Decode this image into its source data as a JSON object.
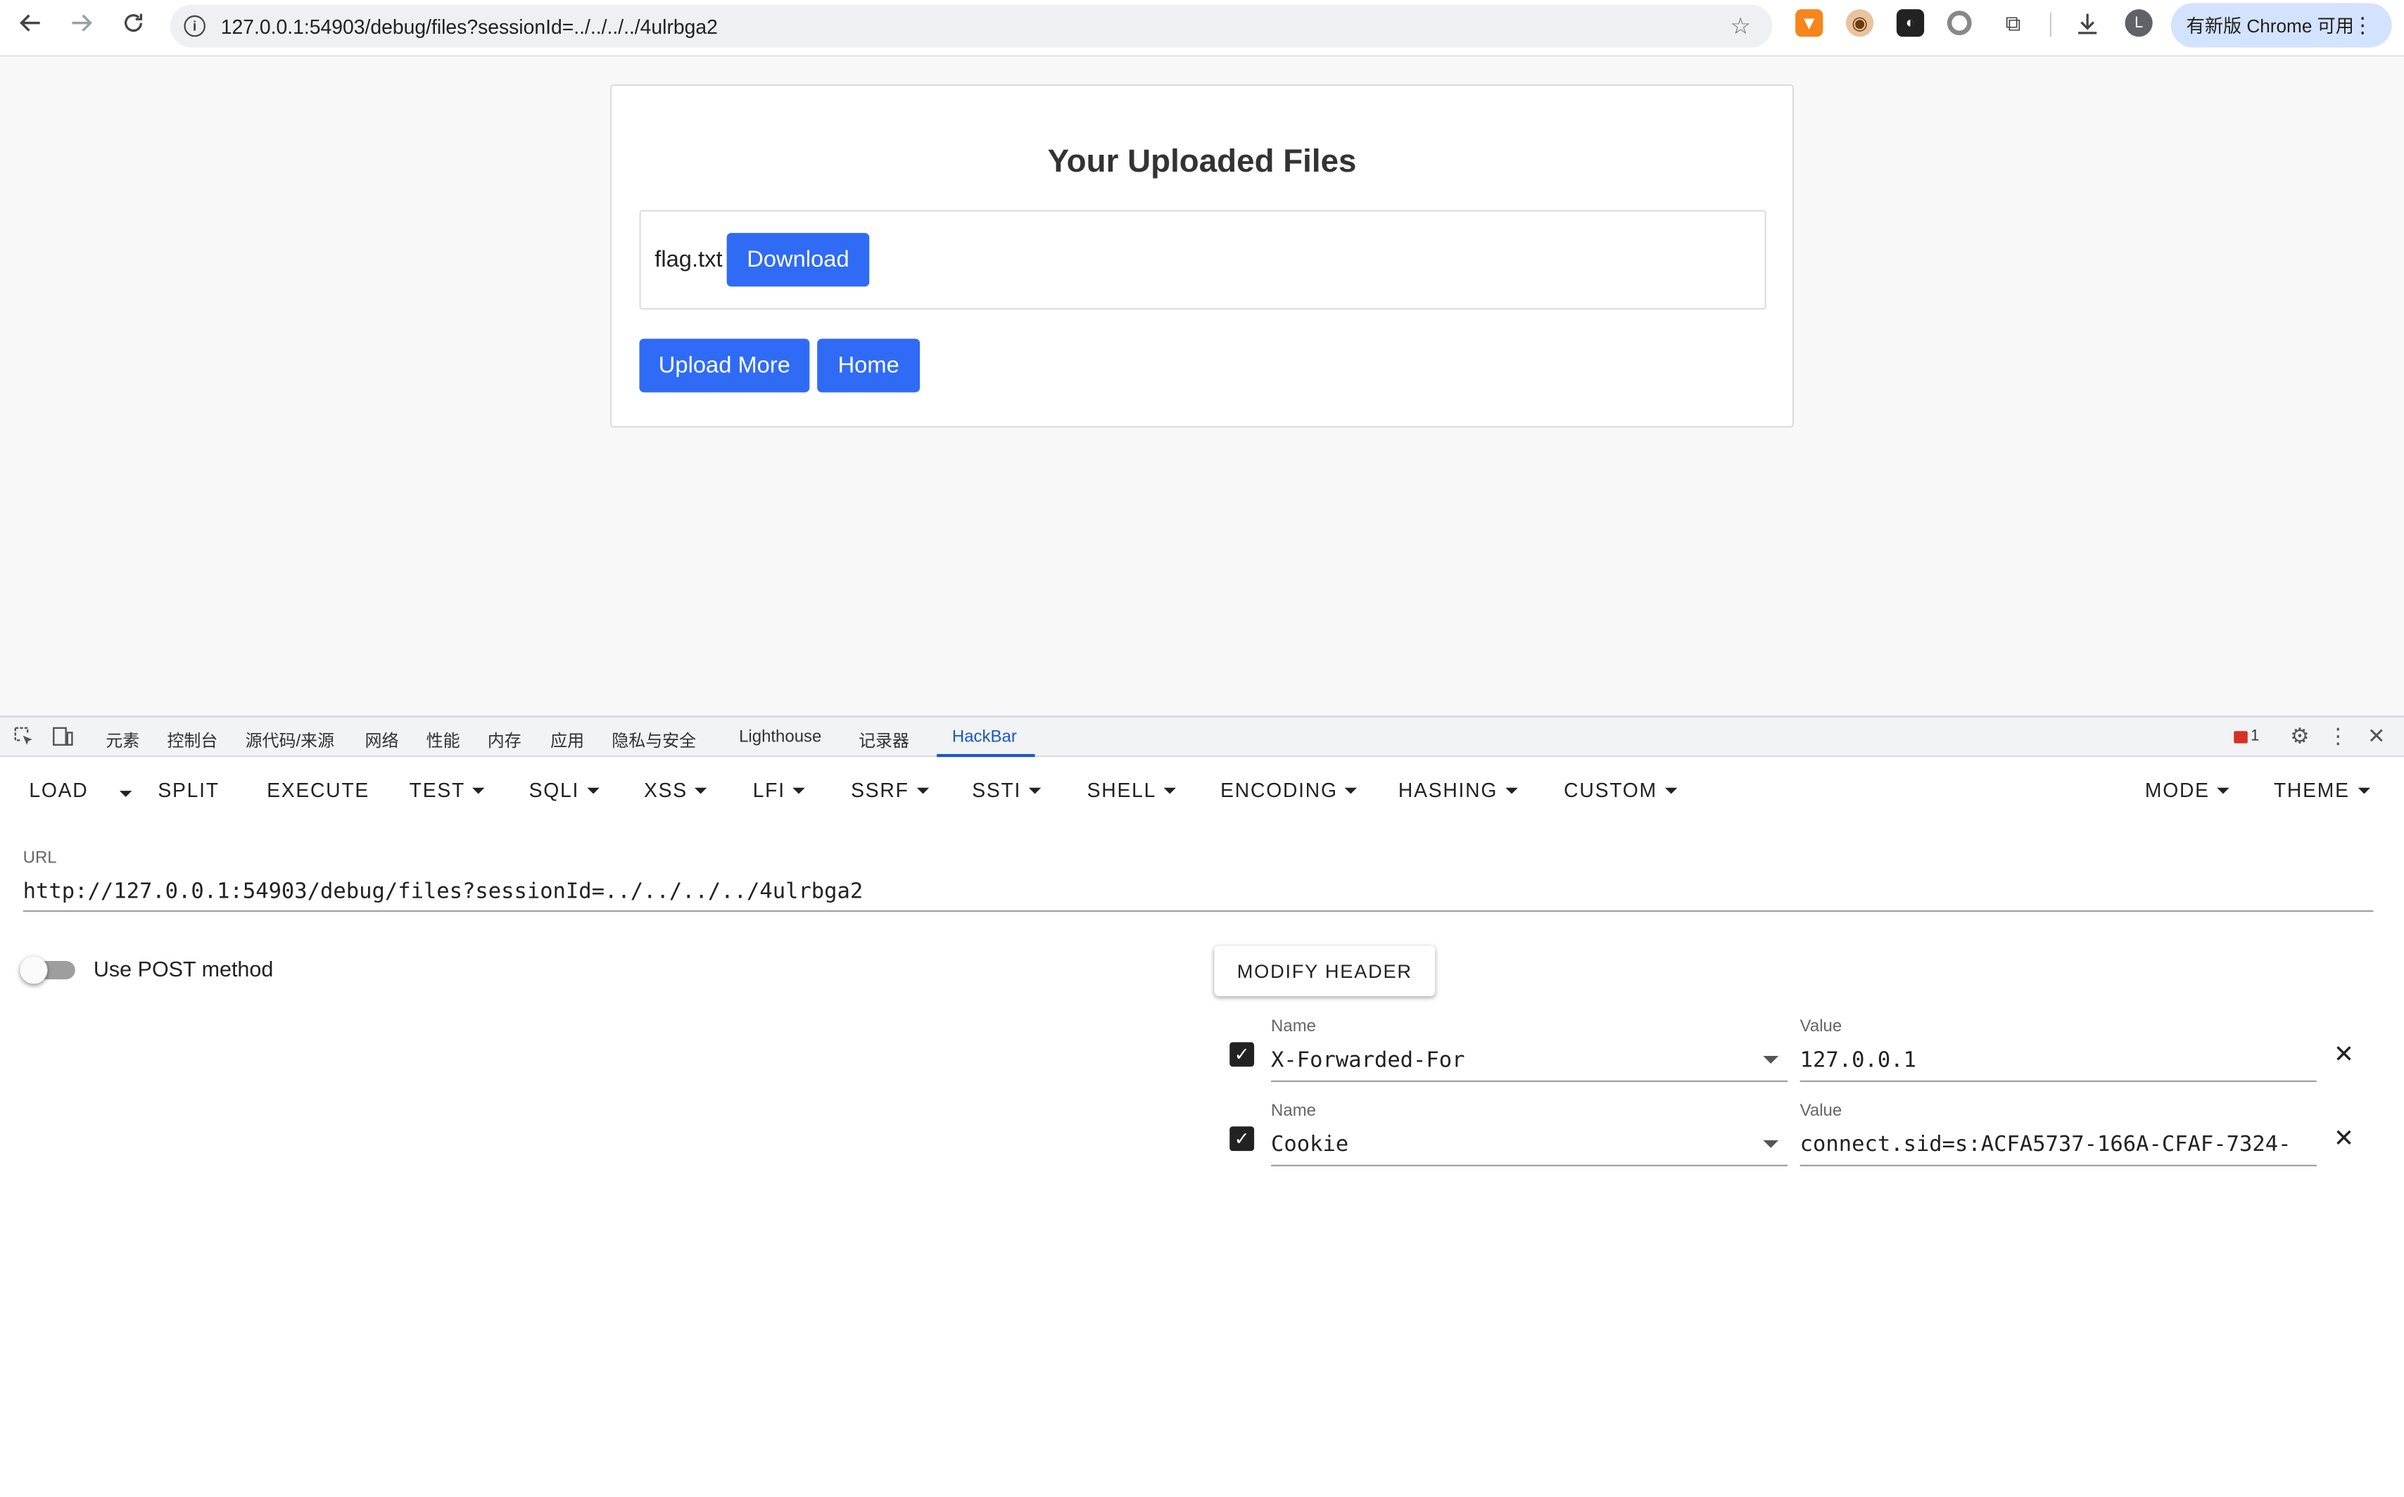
{
  "browser": {
    "url": "127.0.0.1:54903/debug/files?sessionId=../../../../4ulrbga2",
    "update_label": "有新版 Chrome 可用",
    "profile_initial": "L"
  },
  "page": {
    "title": "Your Uploaded Files",
    "file_name": "flag.txt",
    "download_label": "Download",
    "upload_more_label": "Upload More",
    "home_label": "Home"
  },
  "devtools": {
    "tabs": [
      "元素",
      "控制台",
      "源代码/来源",
      "网络",
      "性能",
      "内存",
      "应用",
      "隐私与安全",
      "Lighthouse",
      "记录器",
      "HackBar"
    ],
    "active_tab": "HackBar",
    "issues_count": "1"
  },
  "hackbar": {
    "menu": {
      "load": "LOAD",
      "split": "SPLIT",
      "execute": "EXECUTE",
      "test": "TEST",
      "sqli": "SQLI",
      "xss": "XSS",
      "lfi": "LFI",
      "ssrf": "SSRF",
      "ssti": "SSTI",
      "shell": "SHELL",
      "encoding": "ENCODING",
      "hashing": "HASHING",
      "custom": "CUSTOM",
      "mode": "MODE",
      "theme": "THEME"
    },
    "url_label": "URL",
    "url_value": "http://127.0.0.1:54903/debug/files?sessionId=../../../../4ulrbga2",
    "post_label": "Use POST method",
    "post_enabled": false,
    "modify_header_label": "MODIFY HEADER",
    "headers": [
      {
        "name_label": "Name",
        "name": "X-Forwarded-For",
        "value_label": "Value",
        "value": "127.0.0.1",
        "enabled": true
      },
      {
        "name_label": "Name",
        "name": "Cookie",
        "value_label": "Value",
        "value": "connect.sid=s:ACFA5737-166A-CFAF-7324-",
        "enabled": true
      }
    ]
  }
}
